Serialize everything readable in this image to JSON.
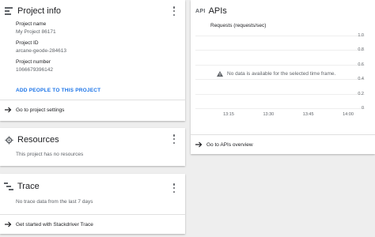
{
  "project_info": {
    "title": "Project info",
    "fields": [
      {
        "label": "Project name",
        "value": "My Project 86171"
      },
      {
        "label": "Project ID",
        "value": "arcane-geode-284613"
      },
      {
        "label": "Project number",
        "value": "1066679396142"
      }
    ],
    "add_people": "ADD PEOPLE TO THIS PROJECT",
    "settings_link": "Go to project settings"
  },
  "resources": {
    "title": "Resources",
    "message": "This project has no resources"
  },
  "trace": {
    "title": "Trace",
    "message": "No trace data from the last 7 days",
    "link": "Get started with Stackdriver Trace"
  },
  "apis": {
    "icon_text": "API",
    "title": "APIs",
    "link": "Go to APIs overview"
  },
  "chart_data": {
    "type": "line",
    "title": "Requests (requests/sec)",
    "x_ticks": [
      "13:15",
      "13:30",
      "13:45",
      "14:00"
    ],
    "y_ticks": [
      "1.0",
      "0.8",
      "0.6",
      "0.4",
      "0.2",
      "0"
    ],
    "ylim": [
      0,
      1.0
    ],
    "series": [],
    "no_data_message": "No data is available for the selected time frame."
  },
  "colors": {
    "accent": "#1a73e8",
    "background": "#eeeeee"
  }
}
